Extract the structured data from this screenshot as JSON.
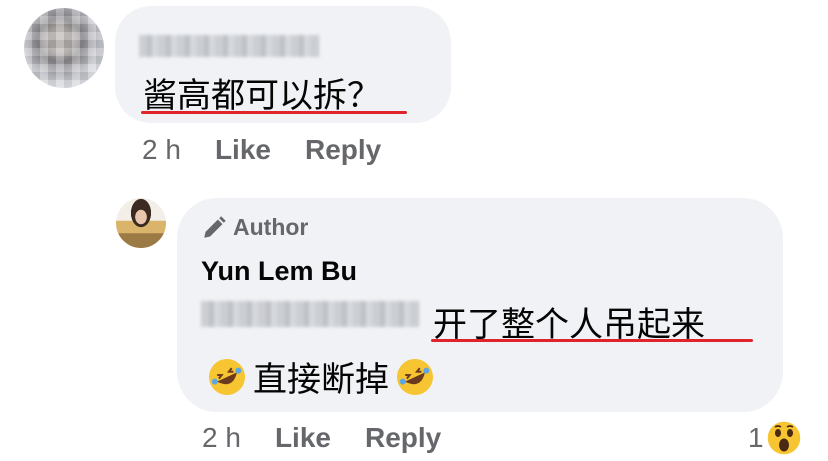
{
  "comment": {
    "text": "酱高都可以拆？",
    "time": "2 h",
    "like_label": "Like",
    "reply_label": "Reply"
  },
  "reply": {
    "badge_label": "Author",
    "author_name": "Yun Lem Bu",
    "text": "开了整个人吊起来",
    "text_line2": "直接断掉",
    "time": "2 h",
    "like_label": "Like",
    "reply_label": "Reply",
    "reaction_count": "1",
    "reaction_icon": "wow-emoji-icon"
  },
  "colors": {
    "bubble": "#f0f2f5",
    "underline": "#e0242b",
    "meta_text": "#65676b",
    "body_text": "#050505"
  }
}
